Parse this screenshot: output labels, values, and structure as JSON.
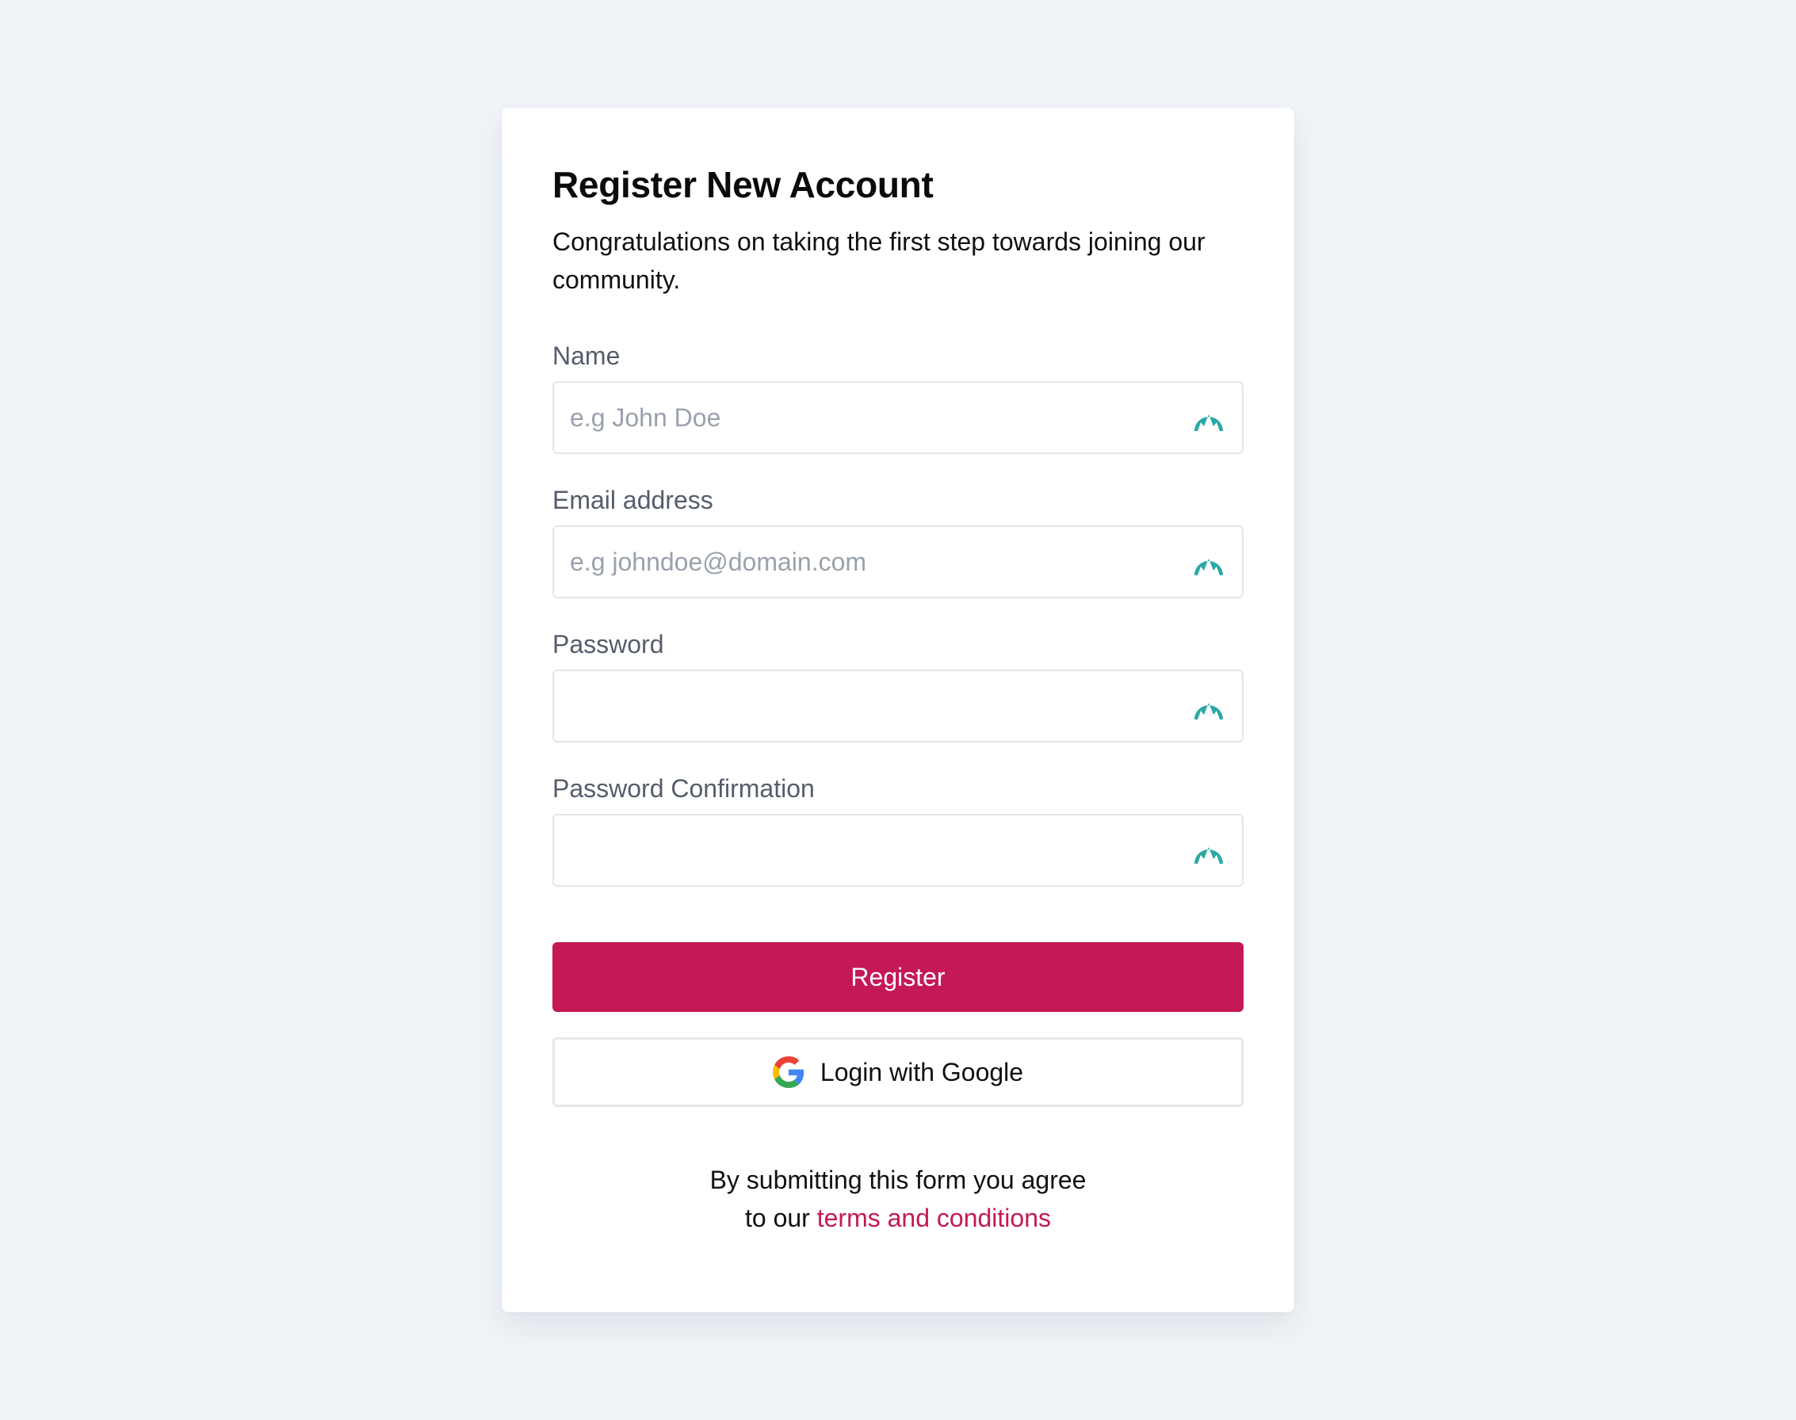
{
  "colors": {
    "background": "#f0f4f8",
    "accent": "#c51856",
    "field_icon": "#2aa9a6"
  },
  "header": {
    "title": "Register New Account",
    "subtitle": "Congratulations on taking the first step towards joining our community."
  },
  "fields": [
    {
      "label": "Name",
      "placeholder": "e.g John Doe",
      "value": "",
      "icon": "lastpass-autofill-icon"
    },
    {
      "label": "Email address",
      "placeholder": "e.g johndoe@domain.com",
      "value": "",
      "icon": "lastpass-autofill-icon"
    },
    {
      "label": "Password",
      "placeholder": "",
      "value": "",
      "icon": "lastpass-autofill-icon"
    },
    {
      "label": "Password Confirmation",
      "placeholder": "",
      "value": "",
      "icon": "lastpass-autofill-icon"
    }
  ],
  "actions": {
    "register_label": "Register",
    "google_label": "Login with Google",
    "google_icon": "google-icon"
  },
  "footer": {
    "line1": "By submitting this form you agree",
    "line2_prefix": "to our",
    "link_text": "terms and conditions"
  }
}
